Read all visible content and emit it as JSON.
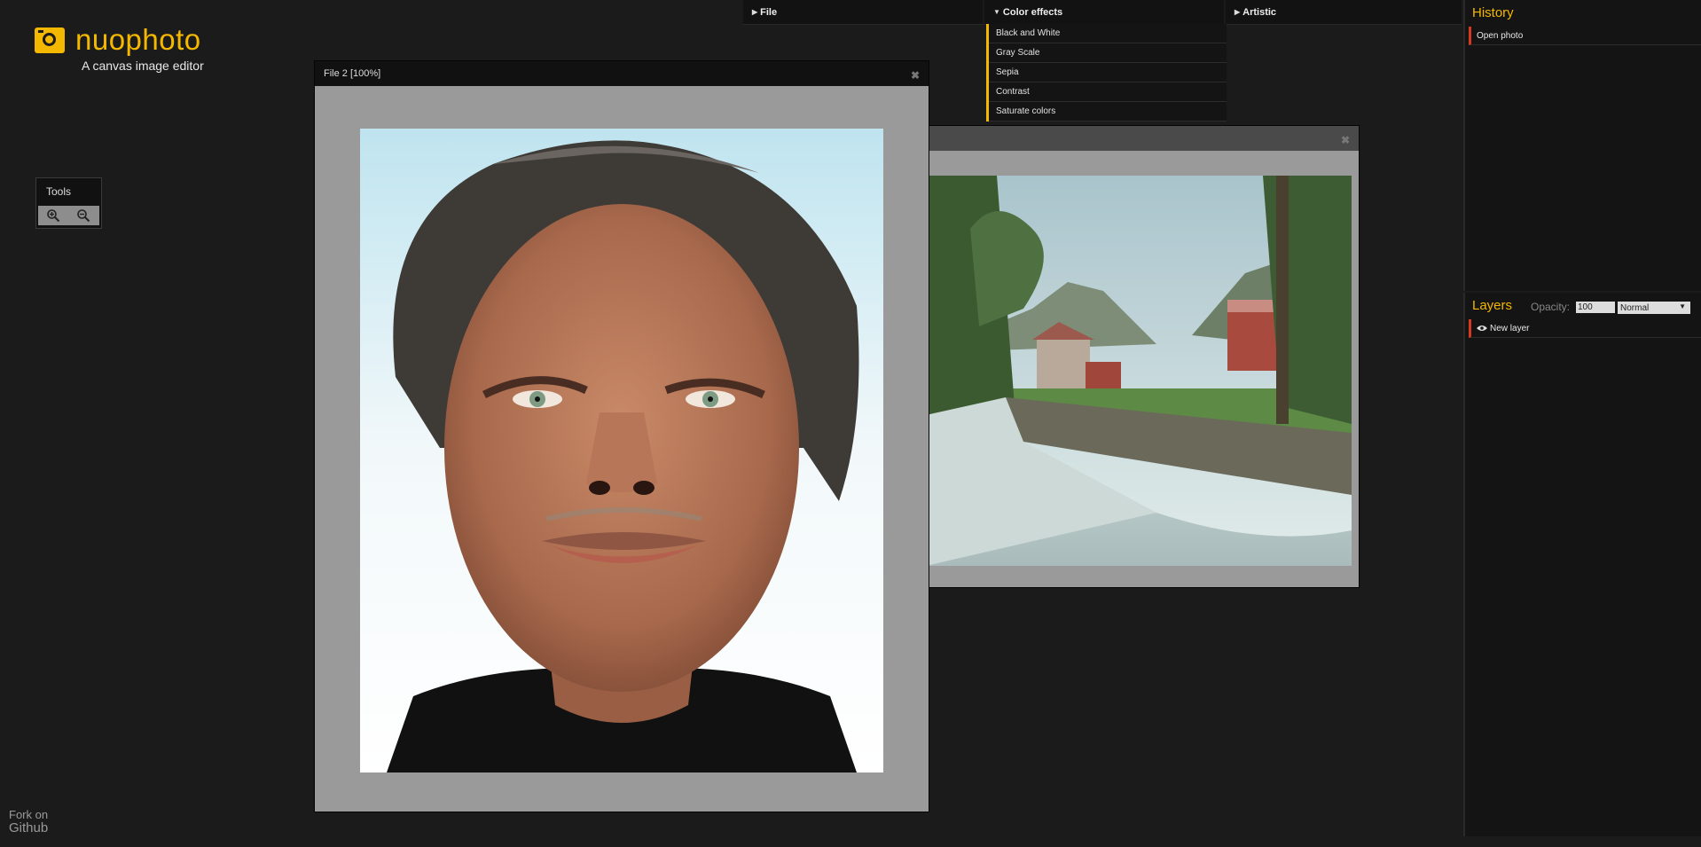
{
  "app": {
    "name": "nuophoto",
    "subtitle": "A canvas image editor",
    "brand_color": "#f5b800",
    "accent_red": "#d63a1e"
  },
  "tools": {
    "title": "Tools",
    "buttons": [
      {
        "name": "zoom-in",
        "icon": "zoom-in-icon"
      },
      {
        "name": "zoom-out",
        "icon": "zoom-out-icon"
      }
    ]
  },
  "menu": {
    "items": [
      {
        "label": "File",
        "expanded": false
      },
      {
        "label": "Color effects",
        "expanded": true
      },
      {
        "label": "Artistic",
        "expanded": false
      }
    ],
    "color_effects": [
      "Black and White",
      "Gray Scale",
      "Sepia",
      "Contrast",
      "Saturate colors"
    ]
  },
  "windows": {
    "file2": {
      "title": "File 2 [100%]",
      "image": "portrait photo of a man"
    },
    "file1": {
      "title": "",
      "image": "landscape photo of a river and houses"
    }
  },
  "history": {
    "title": "History",
    "items": [
      "Open photo"
    ]
  },
  "layers": {
    "title": "Layers",
    "opacity_label": "Opacity:",
    "opacity_value": "100",
    "blend_mode": "Normal",
    "items": [
      {
        "label": "New layer",
        "visible": true
      }
    ]
  },
  "footer": {
    "fork_label": "Fork on",
    "github_label": "Github"
  }
}
